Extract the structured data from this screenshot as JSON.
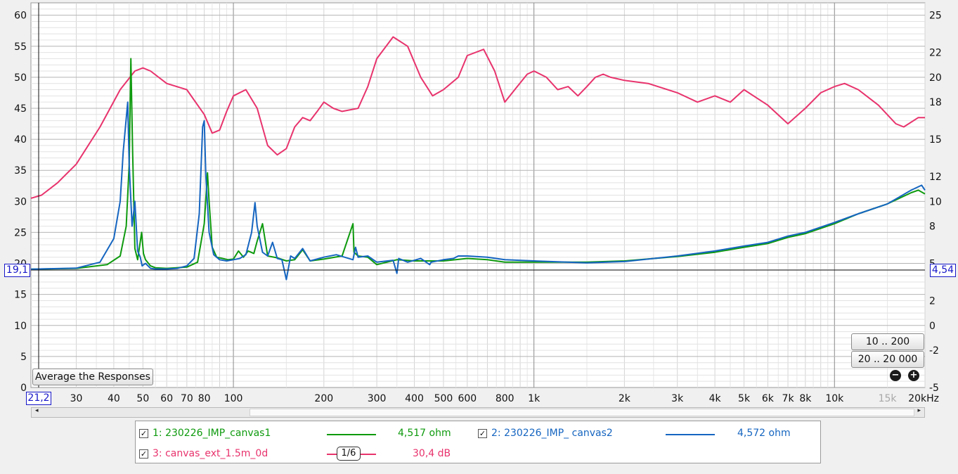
{
  "colors": {
    "series1": "#0e9a0e",
    "series2": "#1565c0",
    "series3": "#e8336d",
    "marker": "#1616c8"
  },
  "chart_data": {
    "type": "line",
    "x_scale": "log",
    "xlim": [
      21.2,
      20000
    ],
    "ylim_left": [
      0,
      62
    ],
    "ylim_right": [
      -5,
      26
    ],
    "x_ticks": [
      "30",
      "40",
      "50",
      "60",
      "70",
      "80",
      "100",
      "200",
      "300",
      "400",
      "500",
      "600",
      "800",
      "1k",
      "2k",
      "3k",
      "4k",
      "5k",
      "6k",
      "7k",
      "8k",
      "10k",
      "15k",
      "20kHz"
    ],
    "y_left_ticks": [
      "0",
      "5",
      "10",
      "15",
      "20",
      "25",
      "30",
      "35",
      "40",
      "45",
      "50",
      "55",
      "60"
    ],
    "y_right_ticks": [
      "-5",
      "-2",
      "0",
      "2",
      "5",
      "8",
      "10",
      "12",
      "15",
      "18",
      "20",
      "22",
      "25"
    ],
    "grid": true,
    "cursor": {
      "left": "19,1",
      "right": "4,54",
      "freq": "21,2"
    },
    "series": [
      {
        "name": "1: 230226_IMP_canvas1",
        "axis": "right",
        "x": [
          21.2,
          30,
          38,
          42,
          44,
          45,
          45.6,
          46.2,
          47,
          48,
          49.5,
          50.2,
          51,
          53,
          55,
          60,
          70,
          76,
          80,
          82,
          83,
          85,
          88,
          92,
          96,
          100,
          104,
          108,
          112,
          117,
          120,
          125,
          130,
          140,
          150,
          160,
          170,
          180,
          200,
          230,
          250,
          252,
          260,
          280,
          300,
          350,
          400,
          500,
          600,
          700,
          800,
          1000,
          1500,
          2000,
          3000,
          4000,
          5000,
          6000,
          7000,
          8000,
          10000,
          12000,
          15000,
          18000,
          19000,
          20000
        ],
        "y": [
          4.54,
          4.6,
          4.9,
          5.6,
          8,
          13,
          21.5,
          14,
          6.2,
          5.3,
          7.5,
          5.8,
          5.3,
          4.8,
          4.65,
          4.6,
          4.7,
          5.1,
          8.2,
          12.3,
          10,
          6.3,
          5.5,
          5.4,
          5.3,
          5.35,
          6,
          5.5,
          6,
          5.8,
          6.8,
          8.2,
          5.6,
          5.45,
          5.2,
          5.3,
          6.1,
          5.2,
          5.35,
          5.6,
          8.2,
          5.9,
          5.6,
          5.5,
          4.9,
          5.3,
          5.2,
          5.2,
          5.4,
          5.3,
          5.1,
          5.1,
          5.1,
          5.2,
          5.55,
          5.9,
          6.3,
          6.6,
          7.1,
          7.4,
          8.2,
          9,
          9.8,
          10.7,
          10.9,
          10.6
        ],
        "value_label": "4,517 ohm"
      },
      {
        "name": "2: 230226_IMP_ canvas2",
        "axis": "right",
        "x": [
          21.2,
          30,
          36,
          40,
          42,
          43,
          44.5,
          45,
          46,
          47,
          48,
          49,
          49.7,
          51,
          53,
          55,
          60,
          65,
          70,
          74,
          77,
          79,
          80,
          81,
          83,
          86,
          90,
          95,
          100,
          105,
          110,
          115,
          118,
          120,
          125,
          130,
          135,
          140,
          145,
          150,
          155,
          160,
          170,
          180,
          200,
          220,
          250,
          255,
          260,
          280,
          300,
          340,
          350,
          355,
          380,
          420,
          450,
          455,
          500,
          540,
          560,
          600,
          700,
          800,
          1000,
          1500,
          2000,
          3000,
          4000,
          5000,
          6000,
          7000,
          8000,
          10000,
          12000,
          15000,
          18000,
          19500,
          20000
        ],
        "y": [
          4.54,
          4.62,
          5.1,
          7,
          10,
          14,
          18,
          13,
          8,
          10,
          6,
          5.5,
          4.8,
          5,
          4.6,
          4.55,
          4.55,
          4.6,
          4.8,
          5.4,
          9,
          16,
          16.5,
          12,
          7.5,
          5.7,
          5.3,
          5.2,
          5.3,
          5.4,
          5.7,
          7.5,
          9.9,
          8,
          5.9,
          5.6,
          6.7,
          5.4,
          5.3,
          3.7,
          5.6,
          5.4,
          6.2,
          5.2,
          5.5,
          5.7,
          5.3,
          6.3,
          5.5,
          5.6,
          5.1,
          5.25,
          4.2,
          5.4,
          5.1,
          5.4,
          4.9,
          5.1,
          5.3,
          5.4,
          5.6,
          5.6,
          5.5,
          5.3,
          5.2,
          5.05,
          5.15,
          5.6,
          6,
          6.4,
          6.7,
          7.2,
          7.5,
          8.3,
          9,
          9.8,
          10.9,
          11.3,
          10.9
        ],
        "value_label": "4,572 ohm"
      },
      {
        "name": "3: canvas_ext_1.5m_0d",
        "axis": "left",
        "x": [
          21.2,
          23,
          26,
          30,
          36,
          42,
          47,
          50,
          53,
          60,
          70,
          80,
          85,
          90,
          95,
          100,
          110,
          120,
          130,
          140,
          150,
          160,
          170,
          180,
          190,
          200,
          215,
          230,
          260,
          280,
          300,
          340,
          380,
          420,
          460,
          500,
          560,
          600,
          680,
          740,
          800,
          880,
          950,
          1000,
          1100,
          1200,
          1300,
          1400,
          1500,
          1600,
          1700,
          1800,
          2000,
          2400,
          3000,
          3500,
          4000,
          4500,
          5000,
          6000,
          7000,
          8000,
          9000,
          10000,
          10800,
          12000,
          14000,
          16000,
          17000,
          19000,
          20000
        ],
        "y": [
          30.5,
          31,
          33,
          36,
          42,
          48,
          51,
          51.5,
          51,
          49,
          48,
          44,
          41,
          41.5,
          44.5,
          47,
          48,
          45,
          39,
          37.5,
          38.5,
          42,
          43.5,
          43,
          44.5,
          46,
          45,
          44.5,
          45,
          48.5,
          53,
          56.5,
          55,
          50,
          47,
          48,
          50,
          53.5,
          54.5,
          51,
          46,
          48.5,
          50.5,
          51,
          50,
          48,
          48.5,
          47,
          48.5,
          50,
          50.5,
          50,
          49.5,
          49,
          47.5,
          46,
          47,
          46,
          48,
          45.5,
          42.5,
          45,
          47.5,
          48.5,
          49,
          48,
          45.5,
          42.5,
          42,
          43.5,
          43.5
        ],
        "value_label": "30,4 dB",
        "smoothing": "1/6"
      }
    ]
  },
  "ui": {
    "average_button": "Average the Responses",
    "range_button_1": "10 .. 200",
    "range_button_2": "20 .. 20 000",
    "zoom_out": "−",
    "zoom_in": "+",
    "check": "✓",
    "scroll_left": "◂",
    "scroll_right": "▸",
    "smooth_badge": "1/6"
  }
}
